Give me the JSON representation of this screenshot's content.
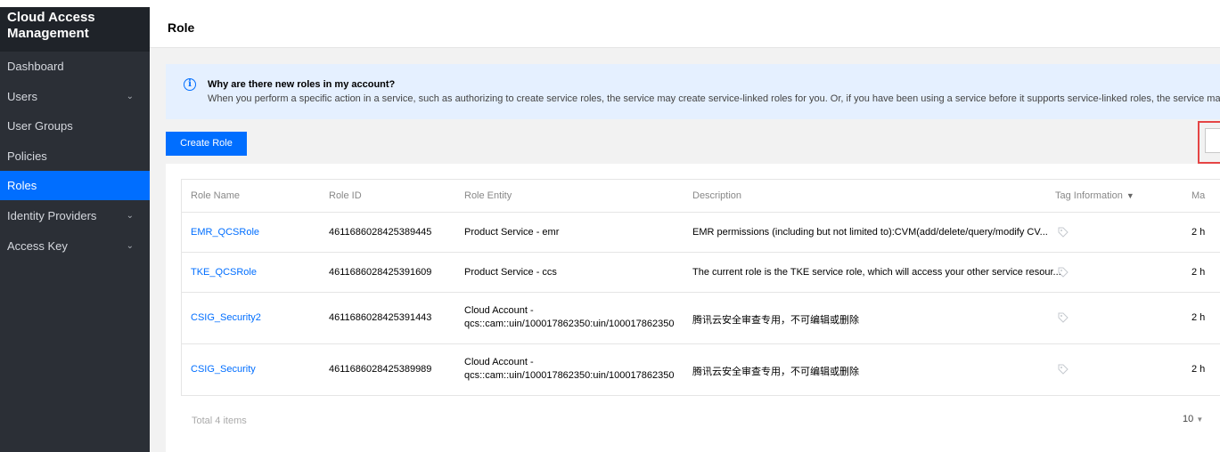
{
  "sidebar": {
    "title_line1": "Cloud Access",
    "title_line2": "Management",
    "items": [
      {
        "label": "Dashboard"
      },
      {
        "label": "Users"
      },
      {
        "label": "User Groups"
      },
      {
        "label": "Policies"
      },
      {
        "label": "Roles"
      },
      {
        "label": "Identity Providers"
      },
      {
        "label": "Access Key"
      }
    ]
  },
  "header": {
    "title": "Role"
  },
  "notice": {
    "title": "Why are there new roles in my account?",
    "text": "When you perform a specific action in a service, such as authorizing to create service roles, the service may create service-linked roles for you. Or, if you have been using a service before it supports service-linked roles, the service may automa"
  },
  "toolbar": {
    "create_label": "Create Role"
  },
  "table": {
    "columns": [
      "Role Name",
      "Role ID",
      "Role Entity",
      "Description",
      "Tag Information",
      "Ma"
    ],
    "rows": [
      {
        "name": "EMR_QCSRole",
        "id": "4611686028425389445",
        "entity_line1": "Product Service - emr",
        "entity_line2": "",
        "description": "EMR permissions (including but not limited to):CVM(add/delete/query/modify CV...",
        "modified": "2 h"
      },
      {
        "name": "TKE_QCSRole",
        "id": "4611686028425391609",
        "entity_line1": "Product Service - ccs",
        "entity_line2": "",
        "description": "The current role is the TKE service role, which will access your other service resour...",
        "modified": "2 h"
      },
      {
        "name": "CSIG_Security2",
        "id": "4611686028425391443",
        "entity_line1": "Cloud Account -",
        "entity_line2": "qcs::cam::uin/100017862350:uin/100017862350",
        "description": "腾讯云安全审查专用，不可编辑或删除",
        "modified": "2 h"
      },
      {
        "name": "CSIG_Security",
        "id": "4611686028425389989",
        "entity_line1": "Cloud Account -",
        "entity_line2": "qcs::cam::uin/100017862350:uin/100017862350",
        "description": "腾讯云安全审查专用，不可编辑或删除",
        "modified": "2 h"
      }
    ],
    "total": "Total 4 items",
    "page_size": "10"
  },
  "colors": {
    "accent": "#006eff",
    "sidebar_bg": "#2b2f36",
    "notice_bg": "#e5f0ff",
    "highlight": "#e54545"
  }
}
